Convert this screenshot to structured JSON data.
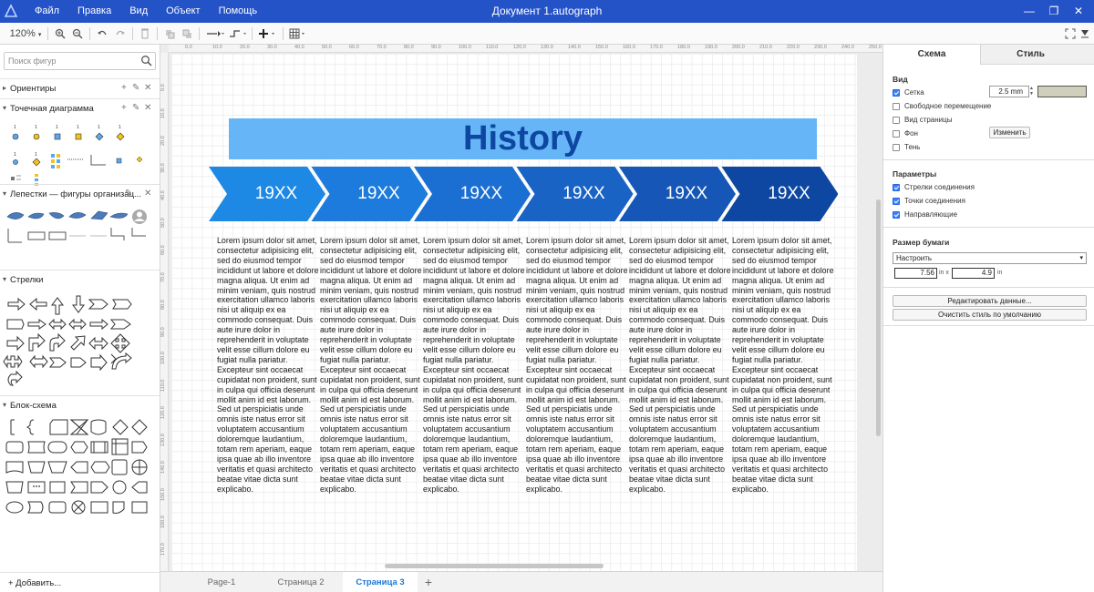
{
  "window": {
    "doc_title": "Документ 1.autograph",
    "menu": [
      "Файл",
      "Правка",
      "Вид",
      "Объект",
      "Помощь"
    ],
    "controls": [
      "—",
      "❐",
      "✕"
    ]
  },
  "toolbar": {
    "zoom": "120%"
  },
  "sidebar": {
    "search_placeholder": "Поиск фигур",
    "sections": [
      {
        "title": "Ориентиры"
      },
      {
        "title": "Точечная диаграмма"
      },
      {
        "title": "Лепестки — фигуры организац..."
      },
      {
        "title": "Стрелки"
      },
      {
        "title": "Блок-схема"
      }
    ],
    "add_more": "+ Добавить..."
  },
  "ruler": {
    "top": [
      "0.0",
      "10.0",
      "20.0",
      "30.0",
      "40.0",
      "50.0",
      "60.0",
      "70.0",
      "80.0",
      "90.0",
      "100.0",
      "110.0",
      "120.0",
      "130.0",
      "140.0",
      "150.0",
      "160.0",
      "170.0",
      "180.0",
      "190.0",
      "200.0",
      "210.0",
      "220.0",
      "230.0",
      "240.0",
      "250.0"
    ],
    "left": [
      "0.0",
      "10.0",
      "20.0",
      "30.0",
      "40.0",
      "50.0",
      "60.0",
      "70.0",
      "80.0",
      "90.0",
      "100.0",
      "110.0",
      "120.0",
      "130.0",
      "140.0",
      "150.0",
      "160.0",
      "170.0"
    ]
  },
  "diagram": {
    "title": "History",
    "banner_color": "#66b5f7",
    "title_color": "#0d47a1",
    "chevron_colors": [
      "#1e88e5",
      "#1c7bdc",
      "#1b6fd2",
      "#1963c4",
      "#1656b6",
      "#0e47a1"
    ],
    "labels": [
      "19XX",
      "19XX",
      "19XX",
      "19XX",
      "19XX",
      "19XX"
    ],
    "lorem": "Lorem ipsum dolor sit amet, consectetur adipisicing elit, sed do eiusmod tempor incididunt ut labore et dolore magna aliqua. Ut enim ad minim veniam, quis nostrud exercitation ullamco laboris nisi ut aliquip ex ea commodo consequat. Duis aute irure dolor in reprehenderit in voluptate velit esse cillum dolore eu fugiat nulla pariatur. Excepteur sint occaecat cupidatat non proident, sunt in culpa qui officia deserunt mollit anim id est laborum. Sed ut perspiciatis unde omnis iste natus error sit voluptatem accusantium doloremque laudantium, totam rem aperiam, eaque ipsa quae ab illo inventore veritatis et quasi architecto beatae vitae dicta sunt explicabo."
  },
  "pages": {
    "tabs": [
      "Page-1",
      "Страница 2",
      "Страница 3"
    ],
    "active": 2,
    "add": "+"
  },
  "panel": {
    "tabs": [
      "Схема",
      "Стиль"
    ],
    "view": {
      "heading": "Вид",
      "grid": "Сетка",
      "grid_size": "2.5 mm",
      "grid_color": "#cfcfbb",
      "free_move": "Свободное перемещение",
      "page_view": "Вид страницы",
      "background": "Фон",
      "change": "Изменить",
      "shadow": "Тень"
    },
    "params": {
      "heading": "Параметры",
      "arrows": "Стрелки соединения",
      "points": "Точки соединения",
      "guides": "Направляющие"
    },
    "paper": {
      "heading": "Размер бумаги",
      "option": "Настроить",
      "width": "7.56",
      "height": "4.9",
      "in1": "in x",
      "in2": "in"
    },
    "edit_data": "Редактировать данные...",
    "clear_style": "Очистить стиль по умолчанию"
  }
}
